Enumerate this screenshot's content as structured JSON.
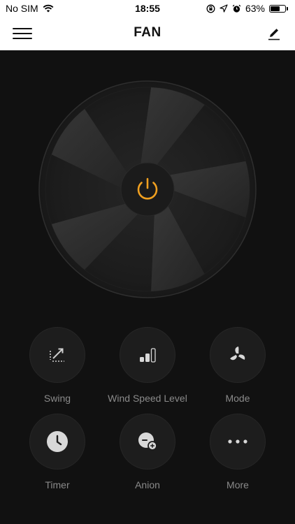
{
  "status_bar": {
    "carrier": "No SIM",
    "time": "18:55",
    "battery_percent": "63%"
  },
  "header": {
    "title": "FAN"
  },
  "controls": [
    {
      "label": "Swing",
      "icon": "swing-icon"
    },
    {
      "label": "Wind Speed Level",
      "icon": "wind-speed-icon"
    },
    {
      "label": "Mode",
      "icon": "fan-mode-icon"
    },
    {
      "label": "Timer",
      "icon": "clock-icon"
    },
    {
      "label": "Anion",
      "icon": "anion-icon"
    },
    {
      "label": "More",
      "icon": "more-icon"
    }
  ],
  "colors": {
    "background": "#111111",
    "accent": "#f0a020",
    "label": "#8a8a8a"
  }
}
